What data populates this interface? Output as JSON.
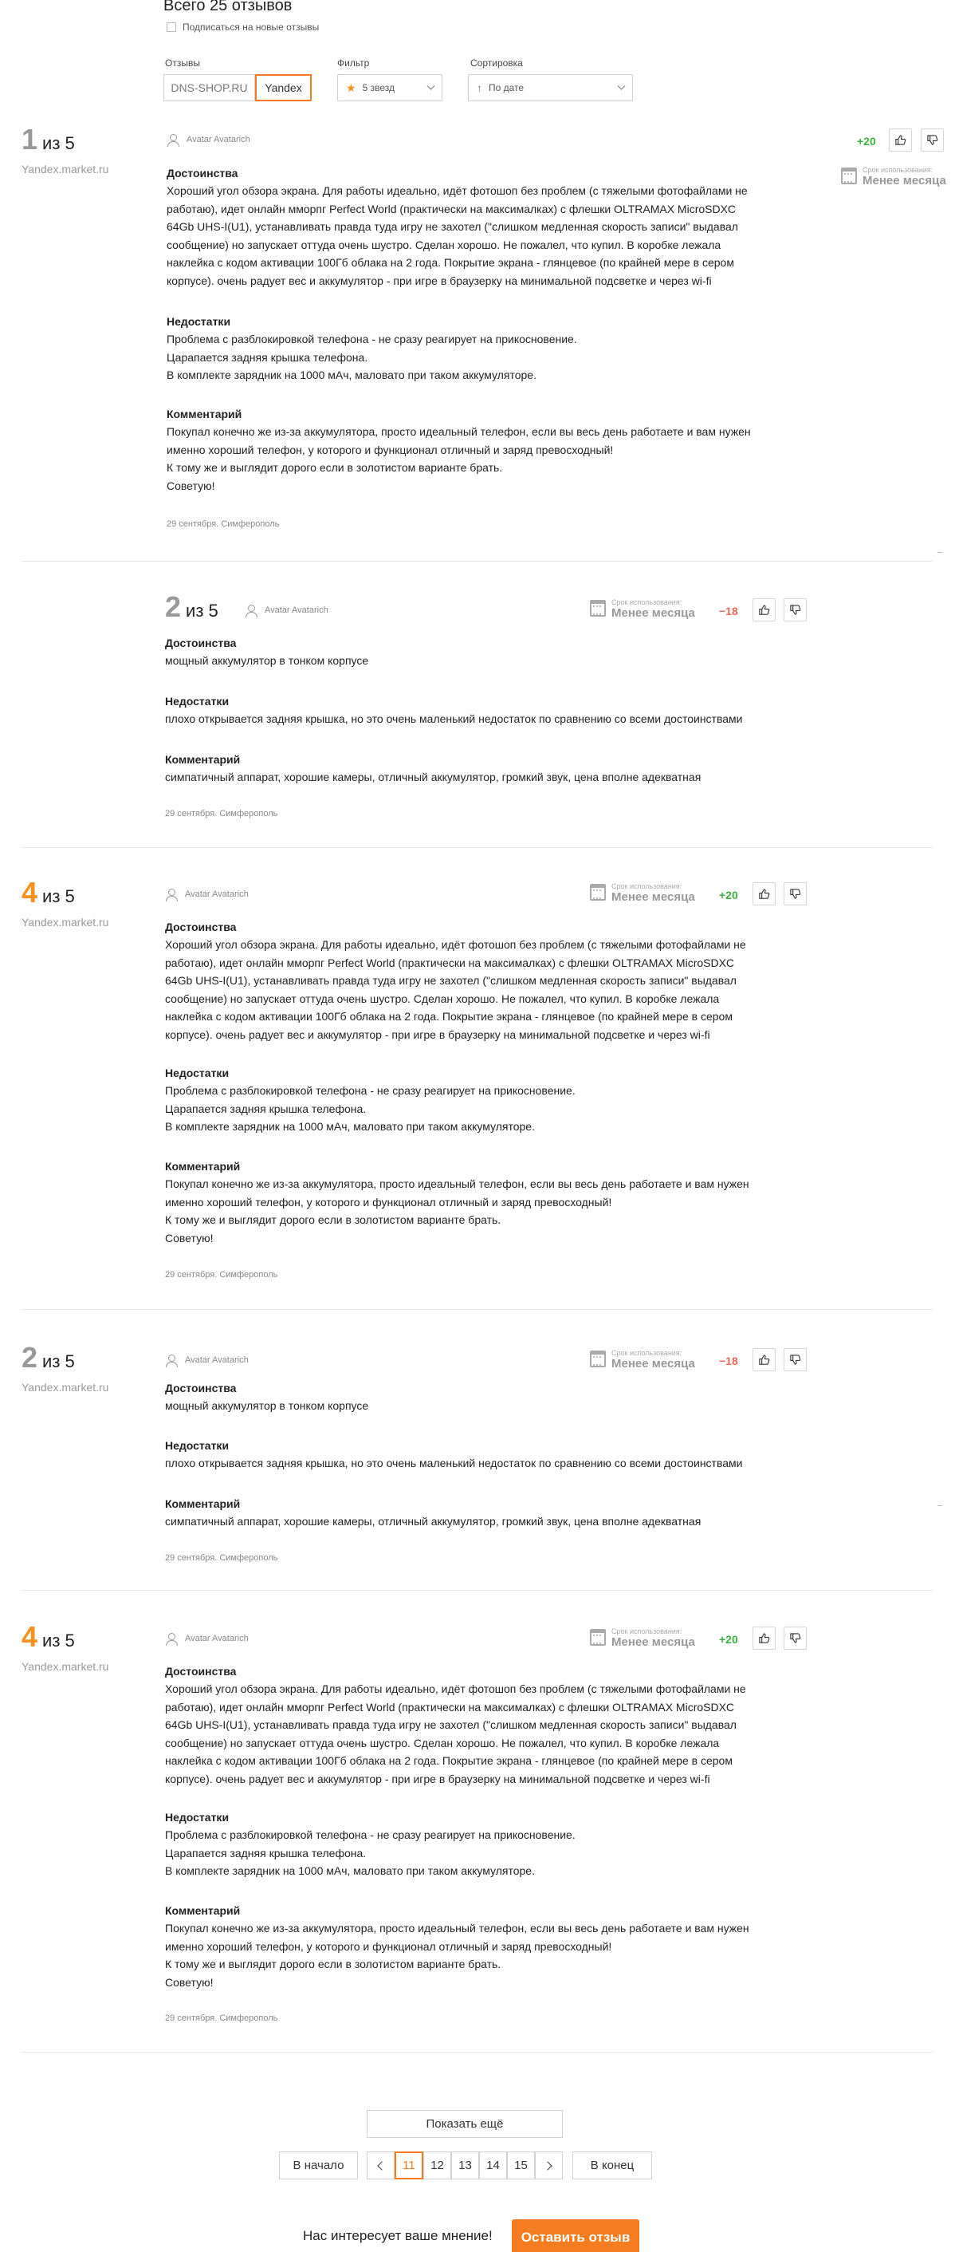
{
  "header": {
    "title": "Всего 25 отзывов",
    "subscribe_label": "Подписаться на новые отзывы"
  },
  "controls": {
    "source_label": "Отзывы",
    "sources": [
      "DNS-SHOP.RU",
      "Yandex"
    ],
    "active_source": "Yandex",
    "filter_label": "Фильтр",
    "filter_value": "5 звезд",
    "sort_label": "Сортировка",
    "sort_value": "По дате"
  },
  "reviews": [
    {
      "rating": "1",
      "of": "из 5",
      "source": "Yandex.market.ru",
      "author": "Avatar Avatarich",
      "usage_label": "Срок использования:",
      "usage_value": "Менее месяца",
      "score": "+20",
      "pros_title": "Достоинства",
      "pros": "Хороший угол обзора экрана. Для работы идеально, идёт фотошоп без проблем (с тяжелыми фотофайлами не\nработаю), идет онлайн ммopпг Perfect World (практически на максималках) с флешки OLTRAMAX MicroSDXC\n64Gb UHS-I(U1), устанавливать правда туда игру не захотел (\"слишком медленная скорость записи\" выдавал\nсообщение) но запускает оттуда очень шустро. Сделан хорошо. Не пожалел, что купил. В коробке лежала\nнаклейка с кодом активации 100Гб облака на 2 года. Покрытие экрана - глянцевое (по крайней мере в сером\nкорпусе). очень радует вес и аккумулятор - при игре в браузерку на минимальной подсветке и через wi-fi",
      "cons_title": "Недостатки",
      "cons": "Проблема с разблокировкой телефона - не сразу реагирует на прикосновение.\nЦарапается задняя крышка телефона.\nВ комплекте зарядник на 1000 мАч, маловато при таком аккумуляторе.",
      "comment_title": "Комментарий",
      "comment": "Покупал конечно же из-за аккумулятора, просто идеальный телефон, если вы весь день работаете и вам нужен\nименно хороший телефон, у которого и функционал отличный и заряд превосходный!\nК тому же и выглядит дорого если в золотистом варианте брать.\nСоветую!",
      "date": "29 сентября. Симферополь"
    },
    {
      "rating": "2",
      "of": "из 5",
      "source": "",
      "author": "Avatar Avatarich",
      "usage_label": "Срок использования:",
      "usage_value": "Менее месяца",
      "score": "−18",
      "pros_title": "Достоинства",
      "pros": "мощный аккумулятор в тонком корпусе",
      "cons_title": "Недостатки",
      "cons": "плохо открывается задняя крышка, но это очень маленький недостаток по сравнению со всеми достоинствами",
      "comment_title": "Комментарий",
      "comment": "симпатичный аппарат, хорошие камеры, отличный аккумулятор, громкий звук, цена вполне адекватная",
      "date": "29 сентября. Симферополь"
    },
    {
      "rating": "4",
      "of": "из 5",
      "source": "Yandex.market.ru",
      "author": "Avatar Avatarich",
      "usage_label": "Срок использования:",
      "usage_value": "Менее месяца",
      "score": "+20",
      "pros_title": "Достоинства",
      "pros": "Хороший угол обзора экрана. Для работы идеально, идёт фотошоп без проблем (с тяжелыми фотофайлами не\nработаю), идет онлайн ммopпг Perfect World (практически на максималках) с флешки OLTRAMAX MicroSDXC\n64Gb UHS-I(U1), устанавливать правда туда игру не захотел (\"слишком медленная скорость записи\" выдавал\nсообщение) но запускает оттуда очень шустро. Сделан хорошо. Не пожалел, что купил. В коробке лежала\nнаклейка с кодом активации 100Гб облака на 2 года. Покрытие экрана - глянцевое (по крайней мере в сером\nкорпусе). очень радует вес и аккумулятор - при игре в браузерку на минимальной подсветке и через wi-fi",
      "cons_title": "Недостатки",
      "cons": "Проблема с разблокировкой телефона - не сразу реагирует на прикосновение.\nЦарапается задняя крышка телефона.\nВ комплекте зарядник на 1000 мАч, маловато при таком аккумуляторе.",
      "comment_title": "Комментарий",
      "comment": "Покупал конечно же из-за аккумулятора, просто идеальный телефон, если вы весь день работаете и вам нужен\nименно хороший телефон, у которого и функционал отличный и заряд превосходный!\nК тому же и выглядит дорого если в золотистом варианте брать.\nСоветую!",
      "date": "29 сентября. Симферополь"
    },
    {
      "rating": "2",
      "of": "из 5",
      "source": "Yandex.market.ru",
      "author": "Avatar Avatarich",
      "usage_label": "Срок использования:",
      "usage_value": "Менее месяца",
      "score": "−18",
      "pros_title": "Достоинства",
      "pros": "мощный аккумулятор в тонком корпусе",
      "cons_title": "Недостатки",
      "cons": "плохо открывается задняя крышка, но это очень маленький недостаток по сравнению со всеми достоинствами",
      "comment_title": "Комментарий",
      "comment": "симпатичный аппарат, хорошие камеры, отличный аккумулятор, громкий звук, цена вполне адекватная",
      "date": "29 сентября. Симферополь"
    },
    {
      "rating": "4",
      "of": "из 5",
      "source": "Yandex.market.ru",
      "author": "Avatar Avatarich",
      "usage_label": "Срок использования:",
      "usage_value": "Менее месяца",
      "score": "+20",
      "pros_title": "Достоинства",
      "pros": "Хороший угол обзора экрана. Для работы идеально, идёт фотошоп без проблем (с тяжелыми фотофайлами не\nработаю), идет онлайн ммopпг Perfect World (практически на максималках) с флешки OLTRAMAX MicroSDXC\n64Gb UHS-I(U1), устанавливать правда туда игру не захотел (\"слишком медленная скорость записи\" выдавал\nсообщение) но запускает оттуда очень шустро. Сделан хорошо. Не пожалел, что купил. В коробке лежала\nнаклейка с кодом активации 100Гб облака на 2 года. Покрытие экрана - глянцевое (по крайней мере в сером\nкорпусе). очень радует вес и аккумулятор - при игре в браузерку на минимальной подсветке и через wi-fi",
      "cons_title": "Недостатки",
      "cons": "Проблема с разблокировкой телефона - не сразу реагирует на прикосновение.\nЦарапается задняя крышка телефона.\nВ комплекте зарядник на 1000 мАч, маловато при таком аккумуляторе.",
      "comment_title": "Комментарий",
      "comment": "Покупал конечно же из-за аккумулятора, просто идеальный телефон, если вы весь день работаете и вам нужен\nименно хороший телефон, у которого и функционал отличный и заряд превосходный!\nК тому же и выглядит дорого если в золотистом варианте брать.\nСоветую!",
      "date": "29 сентября. Симферополь"
    }
  ],
  "pagination": {
    "show_more": "Показать ещё",
    "first": "В начало",
    "pages": [
      "11",
      "12",
      "13",
      "14",
      "15"
    ],
    "current": "11",
    "last": "В конец"
  },
  "footer": {
    "prompt": "Нас интересует ваше мнение!",
    "leave_review": "Оставить отзыв"
  },
  "colors": {
    "accent": "#f57c1f",
    "positive": "#3cb040",
    "negative": "#e86a5a"
  }
}
